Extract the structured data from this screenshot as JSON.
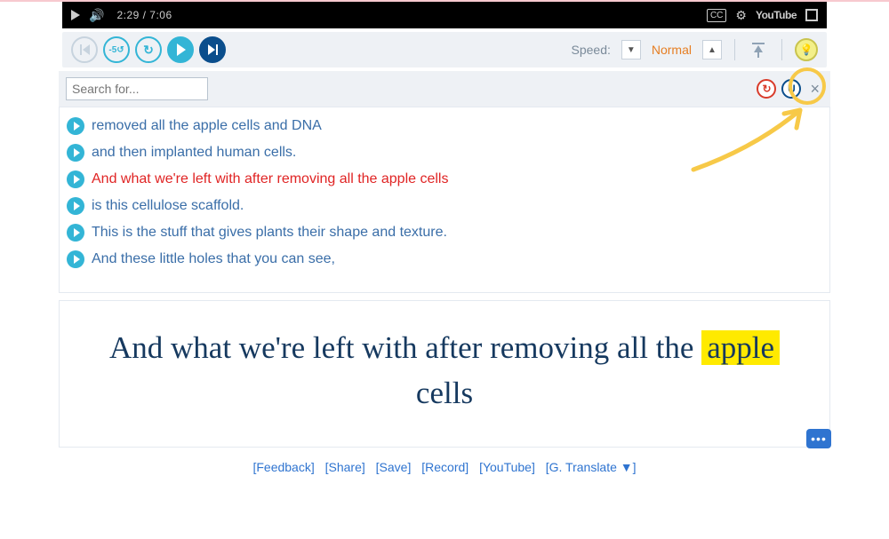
{
  "video": {
    "time": "2:29 / 7:06",
    "youtube_label": "YouTube",
    "cc_label": "CC"
  },
  "controls": {
    "speed_label": "Speed:",
    "speed_value": "Normal"
  },
  "search": {
    "placeholder": "Search for...",
    "badge_reset": "↻",
    "badge_u": "U",
    "close": "×"
  },
  "transcript": [
    {
      "text": "removed all the apple cells and DNA",
      "active": false
    },
    {
      "text": "and then implanted human cells.",
      "active": false
    },
    {
      "text": "And what we're left with after removing all the apple cells",
      "active": true
    },
    {
      "text": "is this cellulose scaffold.",
      "active": false
    },
    {
      "text": "This is the stuff that gives plants their shape and texture.",
      "active": false
    },
    {
      "text": "And these little holes that you can see,",
      "active": false
    }
  ],
  "caption": {
    "prefix": "And what we're left with after removing all the ",
    "highlight": "apple",
    "suffix": " cells"
  },
  "footer": {
    "feedback": "[Feedback]",
    "share": "[Share]",
    "save": "[Save]",
    "record": "[Record]",
    "youtube": "[YouTube]",
    "translate": "[G. Translate  ▼]"
  }
}
